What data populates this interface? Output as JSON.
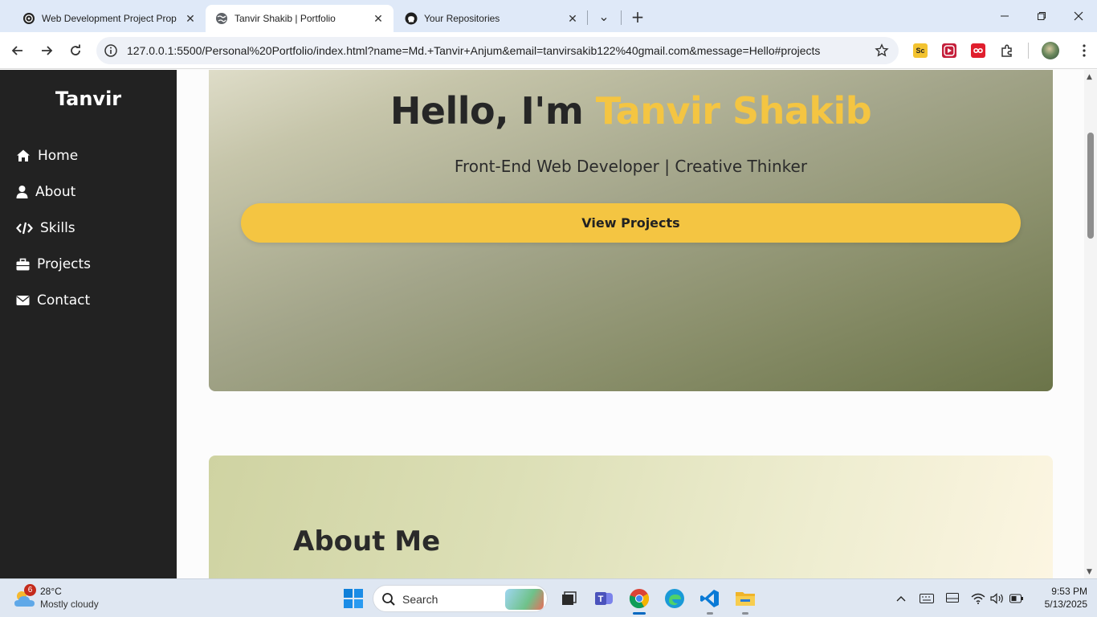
{
  "browser": {
    "tabs": [
      {
        "title": "Web Development Project Prop",
        "icon": "openai-icon",
        "active": false
      },
      {
        "title": "Tanvir Shakib | Portfolio",
        "icon": "globe-icon",
        "active": true
      },
      {
        "title": "Your Repositories",
        "icon": "github-icon",
        "active": false
      }
    ],
    "url": "127.0.0.1:5500/Personal%20Portfolio/index.html?name=Md.+Tanvir+Anjum&email=tanvirsakib122%40gmail.com&message=Hello#projects",
    "extensions": [
      "sc-extension-icon",
      "video-extension-icon",
      "infinity-extension-icon",
      "puzzle-icon"
    ]
  },
  "page": {
    "brand": "Tanvir",
    "nav": [
      {
        "label": "Home",
        "icon": "home-icon"
      },
      {
        "label": "About",
        "icon": "user-icon"
      },
      {
        "label": "Skills",
        "icon": "code-icon"
      },
      {
        "label": "Projects",
        "icon": "briefcase-icon"
      },
      {
        "label": "Contact",
        "icon": "envelope-icon"
      }
    ],
    "hero": {
      "greeting": "Hello, I'm ",
      "name": "Tanvir Shakib",
      "subtitle": "Front-End Web Developer | Creative Thinker",
      "button": "View Projects"
    },
    "about": {
      "title": "About Me"
    },
    "colors": {
      "accent": "#f4c542",
      "sidebar": "#222222"
    }
  },
  "taskbar": {
    "weather": {
      "badge": "6",
      "temp": "28°C",
      "desc": "Mostly cloudy"
    },
    "search_placeholder": "Search",
    "time": "9:53 PM",
    "date": "5/13/2025"
  }
}
